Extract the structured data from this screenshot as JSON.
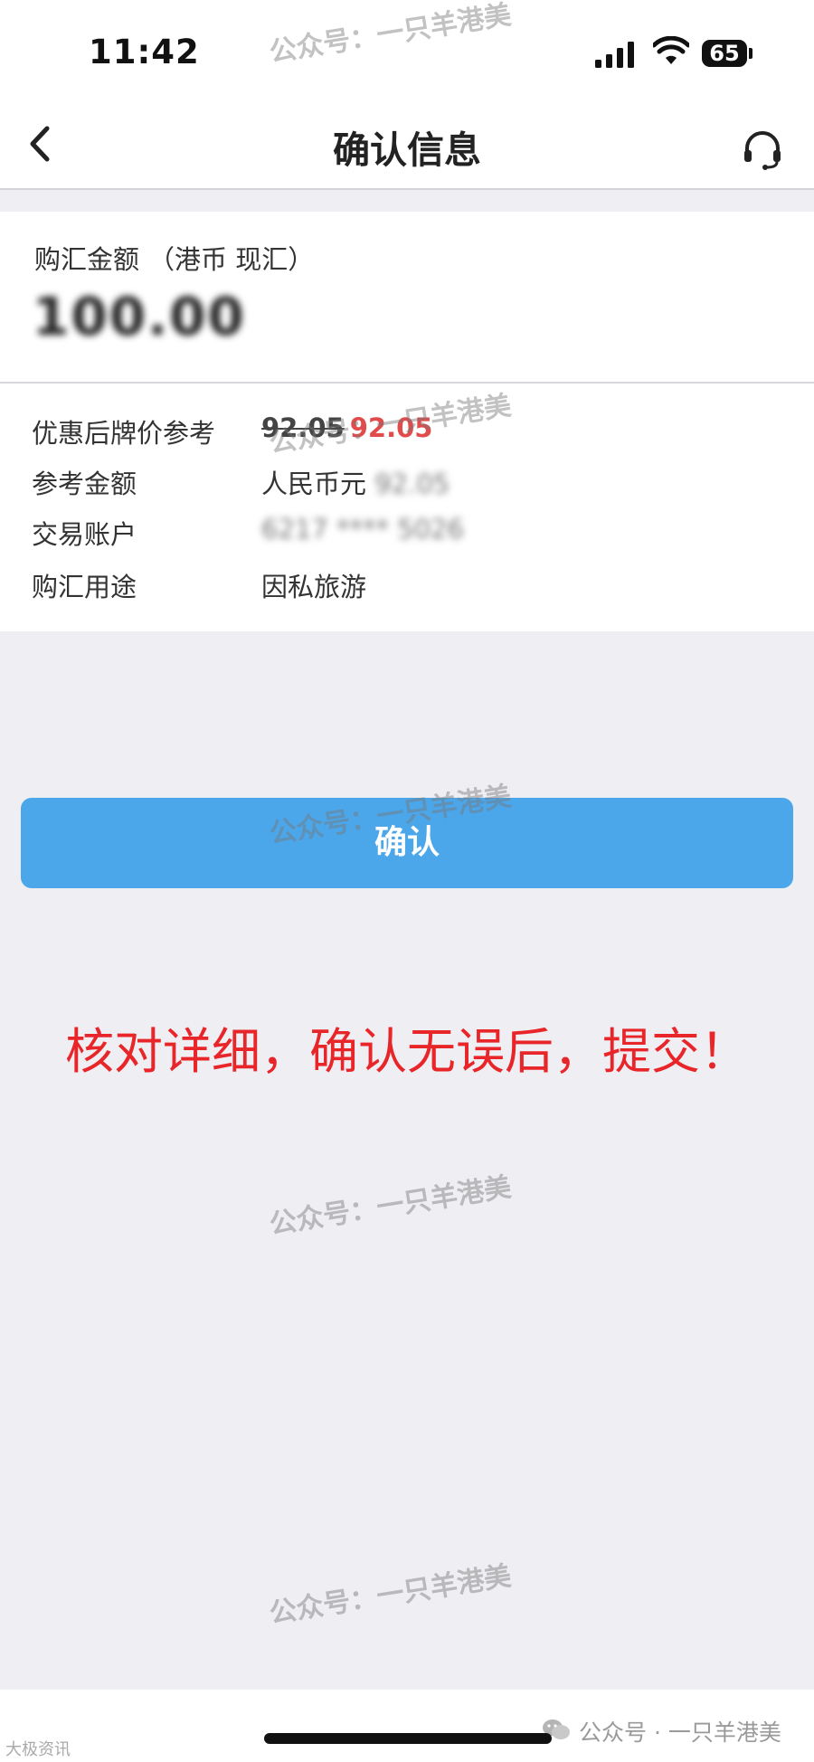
{
  "status_bar": {
    "time": "11:42",
    "battery": "65",
    "icons": [
      "signal-icon",
      "wifi-icon",
      "battery-icon"
    ]
  },
  "nav": {
    "title": "确认信息",
    "back_icon": "chevron-left-icon",
    "service_icon": "headset-icon"
  },
  "amount": {
    "label": "购汇金额",
    "currency": "（港币 现汇）",
    "value": "100.00"
  },
  "details": [
    {
      "label": "优惠后牌价参考",
      "value_old": "92.05",
      "value_new": "92.05"
    },
    {
      "label": "参考金额",
      "value_prefix": "人民币元",
      "value": "92.05"
    },
    {
      "label": "交易账户",
      "value": "6217 **** 5026"
    },
    {
      "label": "购汇用途",
      "value": "因私旅游"
    }
  ],
  "confirm_button": "确认",
  "annotation": "核对详细，确认无误后，提交！",
  "watermark": "公众号：一只羊港美",
  "footer": {
    "source": "公众号 · 一只羊港美",
    "left": "大极资讯"
  },
  "colors": {
    "button": "#4ba6ea",
    "price_highlight": "#e24b4b",
    "annotation": "#e8262a",
    "background": "#eeeef3"
  }
}
